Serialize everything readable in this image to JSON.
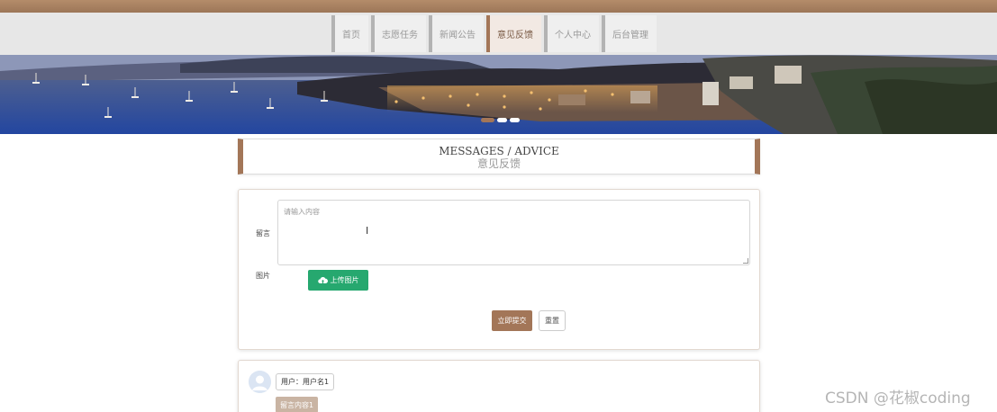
{
  "nav": {
    "items": [
      {
        "label": "首页",
        "active": false
      },
      {
        "label": "志愿任务",
        "active": false
      },
      {
        "label": "新闻公告",
        "active": false
      },
      {
        "label": "意见反馈",
        "active": true
      },
      {
        "label": "个人中心",
        "active": false
      },
      {
        "label": "后台管理",
        "active": false
      }
    ]
  },
  "banner": {
    "slide_count": 3,
    "active_slide": 1
  },
  "section": {
    "title_en": "MESSAGES / ADVICE",
    "title_cn": "意见反馈"
  },
  "form": {
    "message_label": "留言",
    "message_placeholder": "请输入内容",
    "image_label": "图片",
    "upload_label": "上传图片",
    "submit_label": "立即提交",
    "reset_label": "重置"
  },
  "comments": [
    {
      "user": "用户：用户名1",
      "content": "留言内容1"
    }
  ],
  "watermark": "CSDN @花椒coding",
  "colors": {
    "accent": "#a37658",
    "upload": "#26a86f",
    "nav_bg": "#e7e7e7"
  }
}
